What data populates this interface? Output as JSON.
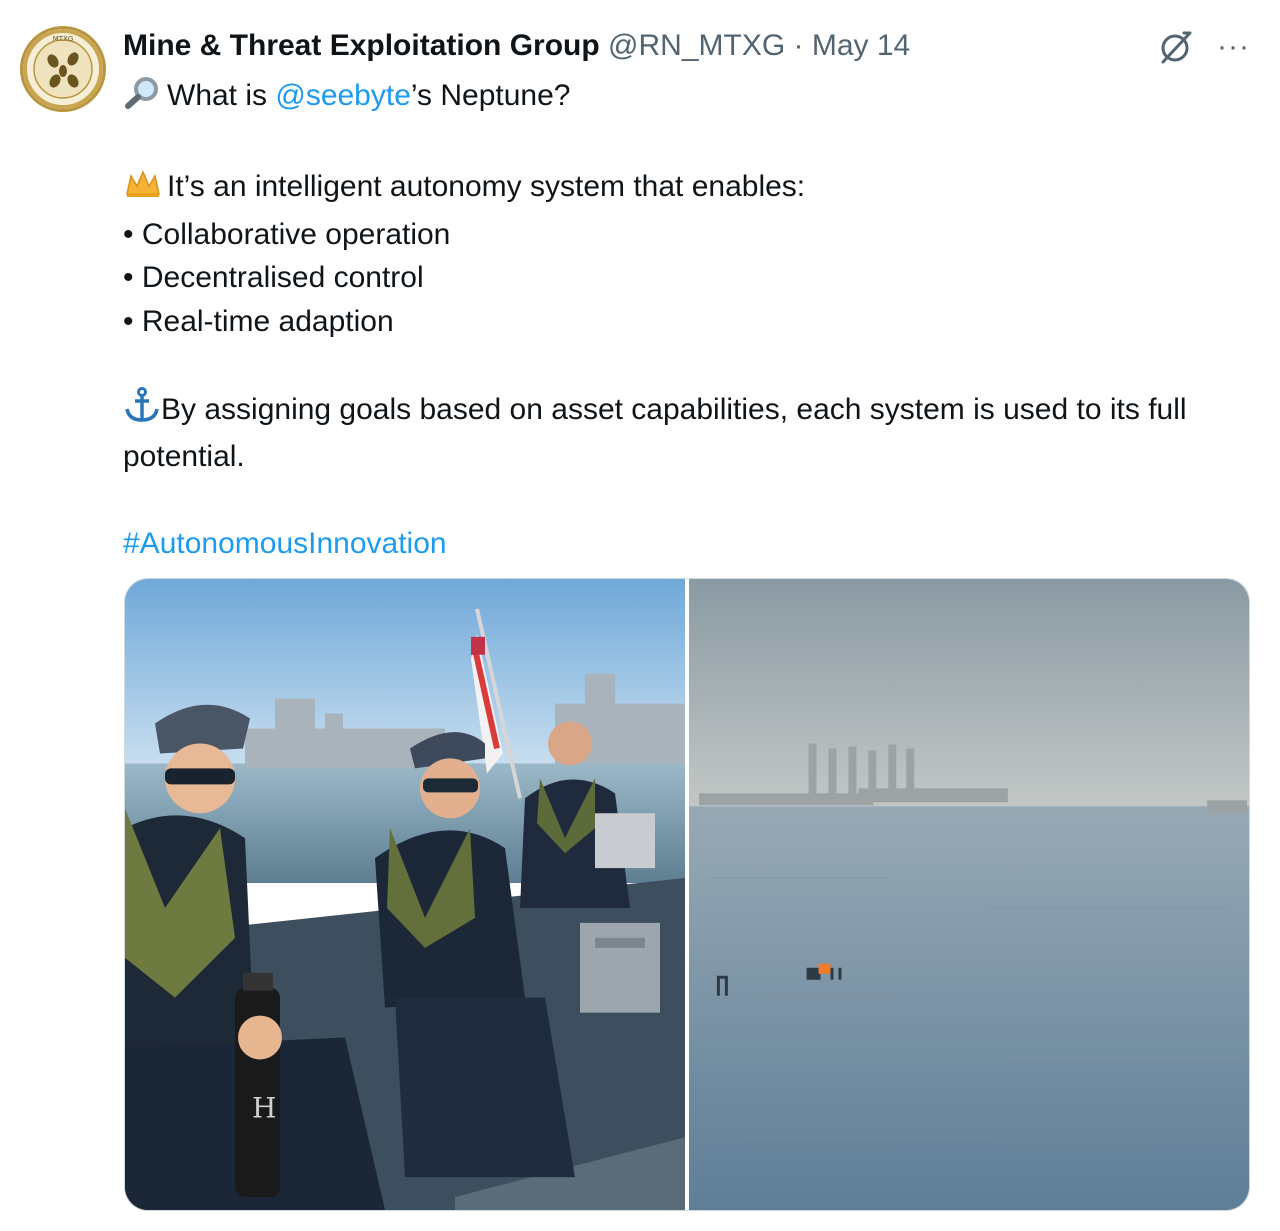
{
  "author": {
    "name": "Mine & Threat Exploitation Group",
    "handle": "@RN_MTXG",
    "separator": "·",
    "date": "May 14",
    "avatar_text": "MTXG"
  },
  "actions": {
    "grok_icon": "grok-icon",
    "more_label": "···"
  },
  "tweet": {
    "line1_before": "What is ",
    "line1_mention": "@seebyte",
    "line1_after": "’s Neptune?",
    "line2": "It’s an intelligent autonomy system that enables:",
    "bullets": [
      "Collaborative operation",
      "Decentralised control",
      "Real-time adaption"
    ],
    "line3": "By assigning goals based on asset capabilities, each system is used to its full potential.",
    "hashtag": "#AutonomousInnovation"
  },
  "media": {
    "left_photo": "photo-crew-on-boat",
    "right_photo": "photo-sea-with-rigs"
  },
  "colors": {
    "link": "#1d9bf0",
    "secondary_text": "#536471",
    "primary_text": "#0f1419"
  }
}
